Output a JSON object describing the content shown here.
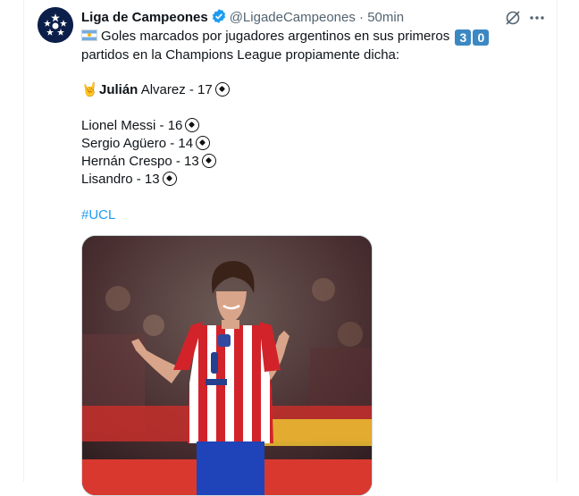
{
  "tweet": {
    "author_name": "Liga de Campeones",
    "handle": "@LigadeCampeones",
    "separator": "·",
    "time": "50min",
    "line1": "Goles marcados por jugadores argentinos en sus primeros",
    "keycap_1": "3",
    "keycap_2": "0",
    "line2": "partidos en la Champions League propiamente dicha:",
    "highlight_first": "Julián",
    "highlight_rest": " Alvarez - 17",
    "players": [
      "Lionel Messi - 16",
      "Sergio Agüero - 14",
      "Hernán Crespo - 13",
      "Lisandro - 13"
    ],
    "hashtag": "#UCL"
  },
  "icons": {
    "verified": "verified-badge-icon",
    "grok": "grok-icon",
    "more": "more-options-icon",
    "flag": "argentina-flag-icon",
    "hand": "horns-hand-icon",
    "ball": "soccer-ball-icon"
  },
  "colors": {
    "accent": "#1d9bf0",
    "keycap": "#3b88c3",
    "muted": "#536471"
  }
}
